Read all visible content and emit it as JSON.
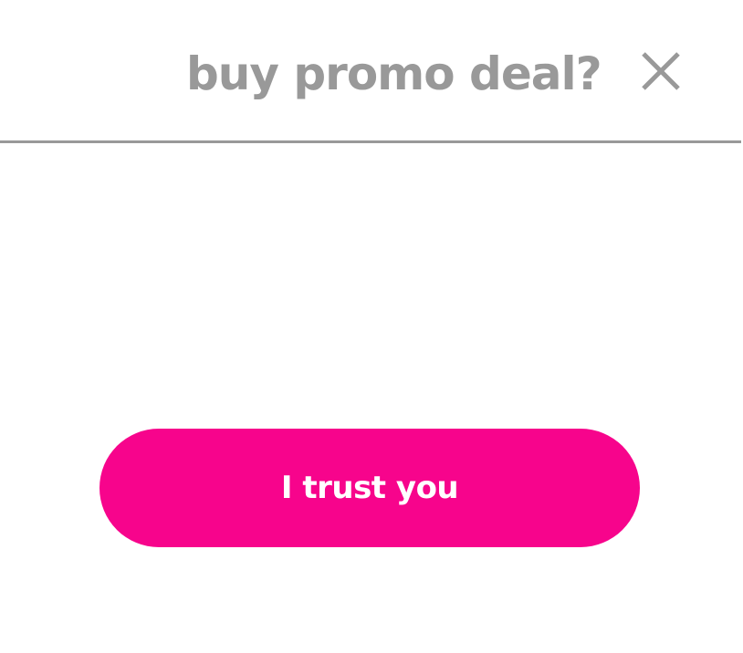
{
  "dialog": {
    "title": "buy promo deal?",
    "close_icon": "close-icon",
    "confirm_label": "I trust you"
  },
  "colors": {
    "title_text": "#999999",
    "divider": "#999999",
    "close_icon": "#999999",
    "accent": "#f7048c",
    "button_text": "#ffffff",
    "background": "#ffffff"
  }
}
